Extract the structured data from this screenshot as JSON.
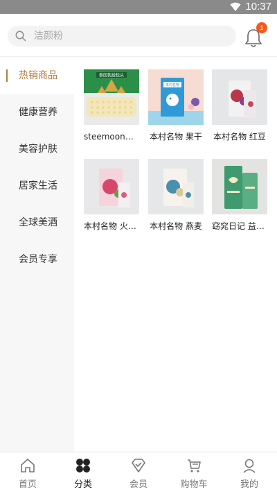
{
  "status_bar": {
    "time": "10:37"
  },
  "search": {
    "placeholder": "洁颜粉"
  },
  "notifications": {
    "badge": "1"
  },
  "sidebar": {
    "items": [
      {
        "label": "热销商品",
        "active": true
      },
      {
        "label": "健康营养",
        "active": false
      },
      {
        "label": "美容护肤",
        "active": false
      },
      {
        "label": "居家生活",
        "active": false
      },
      {
        "label": "全球美酒",
        "active": false
      },
      {
        "label": "会员专享",
        "active": false
      }
    ]
  },
  "products": [
    {
      "name": "steemoon系列乳胶枕",
      "image": "latex-pillow-product-image",
      "box_text": "泰国乳胶枕头"
    },
    {
      "name": "本村名物 果干",
      "image": "fruit-snack-product-image",
      "box_text": "本村名物"
    },
    {
      "name": "本村名物 红豆",
      "image": "red-bean-product-image"
    },
    {
      "name": "本村名物 火龙果",
      "image": "dragon-fruit-product-image"
    },
    {
      "name": "本村名物 燕麦",
      "image": "oat-product-image"
    },
    {
      "name": "窈窕日记 益生菌",
      "image": "slim-diary-product-image"
    }
  ],
  "tabbar": {
    "items": [
      {
        "label": "首页",
        "icon": "home-icon",
        "active": false
      },
      {
        "label": "分类",
        "icon": "category-icon",
        "active": true
      },
      {
        "label": "会员",
        "icon": "member-icon",
        "active": false
      },
      {
        "label": "购物车",
        "icon": "cart-icon",
        "active": false
      },
      {
        "label": "我的",
        "icon": "profile-icon",
        "active": false
      }
    ]
  }
}
